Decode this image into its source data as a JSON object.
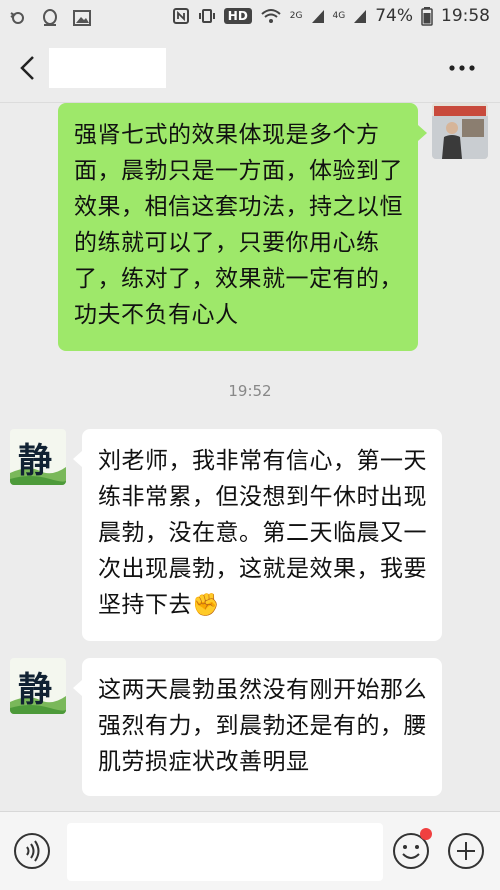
{
  "status_bar": {
    "hd": "HD",
    "signal_2g": "2G",
    "signal_4g": "4G",
    "battery": "74%",
    "time": "19:58"
  },
  "header": {
    "title": ""
  },
  "avatars": {
    "peer_glyph": "静"
  },
  "messages": [
    {
      "direction": "outgoing",
      "text": "强肾七式的效果体现是多个方面，晨勃只是一方面，体验到了效果，相信这套功法，持之以恒的练就可以了，只要你用心练了，练对了，效果就一定有的，功夫不负有心人"
    },
    {
      "type": "timestamp",
      "text": "19:52"
    },
    {
      "direction": "incoming",
      "text": "刘老师，我非常有信心，第一天练非常累，但没想到午休时出现晨勃，没在意。第二天临晨又一次出现晨勃，这就是效果，我要坚持下去",
      "emoji": "✊"
    },
    {
      "direction": "incoming",
      "text": "这两天晨勃虽然没有刚开始那么强烈有力，到晨勃还是有的，腰肌劳损症状改善明显"
    }
  ],
  "input": {
    "placeholder": "",
    "value": ""
  },
  "icons": {
    "back": "back-arrow-icon",
    "more": "more-dots-icon",
    "voice": "voice-icon",
    "emoji": "smiley-icon",
    "plus": "plus-icon"
  },
  "colors": {
    "outgoing_bubble": "#9ee86a",
    "incoming_bubble": "#ffffff",
    "background": "#ececec",
    "unread_dot": "#f04040"
  }
}
